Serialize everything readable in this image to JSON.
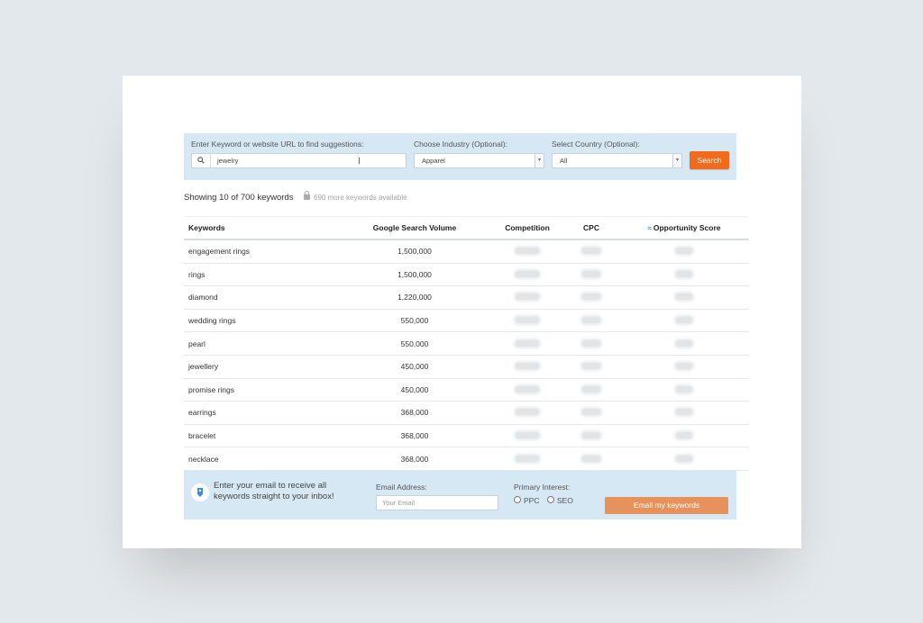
{
  "search": {
    "keyword_label": "Enter Keyword or website URL to find suggestions:",
    "keyword_value": "jewelry",
    "industry_label": "Choose Industry (Optional):",
    "industry_value": "Apparel",
    "country_label": "Select Country (Optional):",
    "country_value": "All",
    "button_label": "Search"
  },
  "summary": {
    "showing": "Showing 10 of 700 keywords",
    "more": "690 more keywords available"
  },
  "table": {
    "headers": {
      "keywords": "Keywords",
      "volume": "Google Search Volume",
      "competition": "Competition",
      "cpc": "CPC",
      "opportunity": "Opportunity Score"
    },
    "rows": [
      {
        "keyword": "engagement rings",
        "volume": "1,500,000"
      },
      {
        "keyword": "rings",
        "volume": "1,500,000"
      },
      {
        "keyword": "diamond",
        "volume": "1,220,000"
      },
      {
        "keyword": "wedding rings",
        "volume": "550,000"
      },
      {
        "keyword": "pearl",
        "volume": "550,000"
      },
      {
        "keyword": "jewellery",
        "volume": "450,000"
      },
      {
        "keyword": "promise rings",
        "volume": "450,000"
      },
      {
        "keyword": "earrings",
        "volume": "368,000"
      },
      {
        "keyword": "bracelet",
        "volume": "368,000"
      },
      {
        "keyword": "necklace",
        "volume": "368,000"
      }
    ]
  },
  "email": {
    "prompt": "Enter your email to receive all keywords straight to your inbox!",
    "address_label": "Email Address:",
    "address_placeholder": "Your Email",
    "interest_label": "Primary Interest:",
    "options": [
      "PPC",
      "SEO"
    ],
    "button_label": "Email my keywords"
  },
  "colors": {
    "panel": "#d6e8f4",
    "search_button": "#f26b1d",
    "email_button": "#e8925b"
  }
}
